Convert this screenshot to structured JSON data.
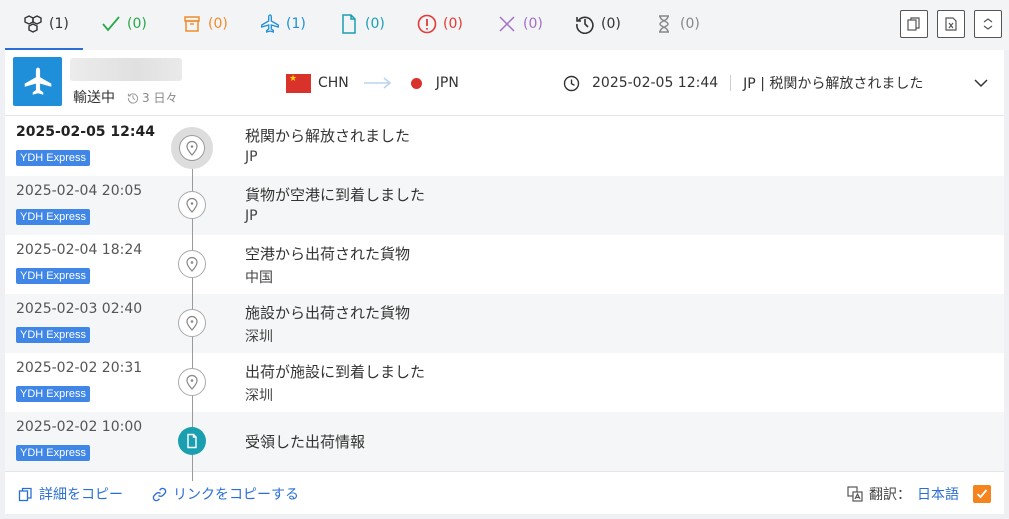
{
  "tabs": [
    {
      "icon": "packages-icon",
      "count": "(1)",
      "color": "#333333"
    },
    {
      "icon": "check-icon",
      "count": "(0)",
      "color": "#2ba84a"
    },
    {
      "icon": "box-icon",
      "count": "(0)",
      "color": "#f08c2a"
    },
    {
      "icon": "plane-icon",
      "count": "(1)",
      "color": "#1e8fd8"
    },
    {
      "icon": "document-icon",
      "count": "(0)",
      "color": "#1a9fb1"
    },
    {
      "icon": "alert-icon",
      "count": "(0)",
      "color": "#e53935"
    },
    {
      "icon": "cross-icon",
      "count": "(0)",
      "color": "#a36fc7"
    },
    {
      "icon": "history-icon",
      "count": "(0)",
      "color": "#333333"
    },
    {
      "icon": "hourglass-icon",
      "count": "(0)",
      "color": "#888888"
    }
  ],
  "shipment": {
    "status": "輸送中",
    "days": "3 日々",
    "origin": "CHN",
    "destination": "JPN",
    "latest_time": "2025-02-05 12:44",
    "latest_event": "JP | 税関から解放されました"
  },
  "events": [
    {
      "time": "2025-02-05 12:44",
      "carrier": "YDH Express",
      "title": "税関から解放されました",
      "location": "JP"
    },
    {
      "time": "2025-02-04 20:05",
      "carrier": "YDH Express",
      "title": "貨物が空港に到着しました",
      "location": "JP"
    },
    {
      "time": "2025-02-04 18:24",
      "carrier": "YDH Express",
      "title": "空港から出荷された貨物",
      "location": "中国"
    },
    {
      "time": "2025-02-03 02:40",
      "carrier": "YDH Express",
      "title": "施設から出荷された貨物",
      "location": "深圳"
    },
    {
      "time": "2025-02-02 20:31",
      "carrier": "YDH Express",
      "title": "出荷が施設に到着しました",
      "location": "深圳"
    },
    {
      "time": "2025-02-02 10:00",
      "carrier": "YDH Express",
      "title": "受領した出荷情報",
      "location": ""
    }
  ],
  "footer": {
    "copy_details": "詳細をコピー",
    "copy_link": "リンクをコピーする",
    "translate_label": "翻訳：",
    "translate_lang": "日本語"
  },
  "colors": {
    "accent": "#2b6fd6",
    "badge": "#1e8fd8",
    "carrier": "#3f86e6",
    "checkbox": "#f5841f"
  }
}
